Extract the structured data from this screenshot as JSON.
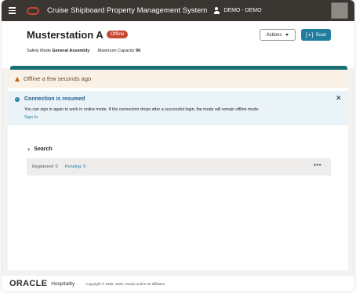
{
  "topbar": {
    "menu_icon": "hamburger-icon",
    "logo_icon": "oracle-logo-icon",
    "title": "Cruise Shipboard Property Management System",
    "user_icon": "user-icon",
    "user_name": "DEMO - DEMO"
  },
  "header": {
    "title": "Musterstation A",
    "badge": "Offline",
    "safety_mode_label": "Safety Mode",
    "safety_mode_value": "General Assembly",
    "capacity_label": "Maximum Capacity",
    "capacity_value": "96",
    "actions_label": "Actions",
    "scan_label": "Scan"
  },
  "offline_banner": {
    "icon": "warning-icon",
    "text": "Offline a few seconds ago"
  },
  "info_banner": {
    "icon": "info-icon",
    "title": "Connection is resumed",
    "body": "You can sign in again to work in online mode. If the connection drops after a successful login, the mode will remain offline mode.",
    "link": "Sign In",
    "close_icon": "close-icon"
  },
  "search": {
    "label": "Search"
  },
  "status": {
    "registered": "Registered: 0",
    "pending": "Pending: 9",
    "more": "•••"
  },
  "footer": {
    "brand": "ORACLE",
    "product": "Hospitality",
    "copyright": "Copyright © 1995, 2025, Oracle and/or its affiliates."
  },
  "colors": {
    "topbar": "#3a3632",
    "brand_red": "#c74634",
    "accent_teal": "#227e9e",
    "banner_warning_bg": "#faf1e6",
    "banner_info_bg": "#eaf3f8"
  }
}
